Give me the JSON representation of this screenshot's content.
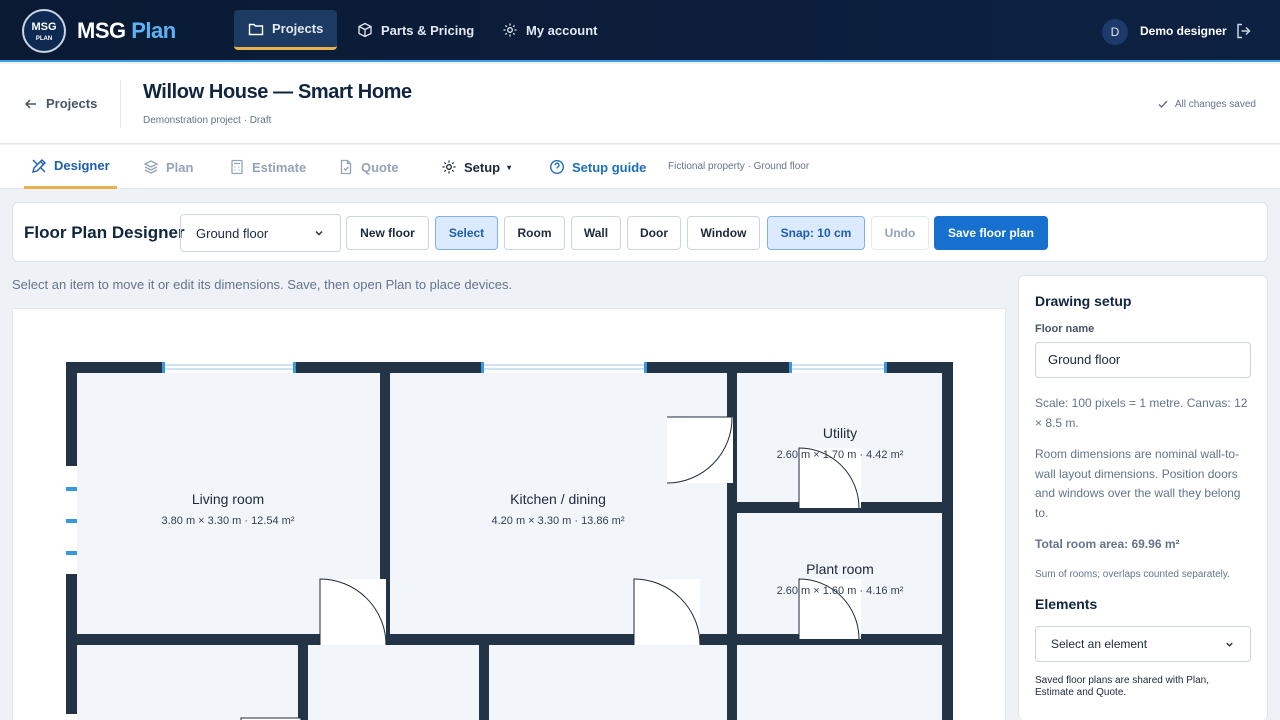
{
  "brand": {
    "logo_line1": "MSG",
    "logo_line2": "PLAN",
    "name": "MSG",
    "name_accent": "Plan"
  },
  "nav": {
    "projects": "Projects",
    "parts": "Parts & Pricing",
    "account": "My account",
    "user_initial": "D",
    "user_name": "Demo designer"
  },
  "project": {
    "back": "Projects",
    "title": "Willow House — Smart Home",
    "subtitle": "Demonstration project · Draft",
    "saved": "All changes saved"
  },
  "tabs": {
    "designer": "Designer",
    "plan": "Plan",
    "estimate": "Estimate",
    "quote": "Quote",
    "setup": "Setup",
    "setup_caret": "▾",
    "guide": "Setup guide",
    "note": "Fictional property · Ground floor"
  },
  "toolbar": {
    "title": "Floor Plan Designer",
    "floor": "Ground floor",
    "new_floor": "New floor",
    "select": "Select",
    "room": "Room",
    "wall": "Wall",
    "door": "Door",
    "window": "Window",
    "snap": "Snap: 10 cm",
    "undo": "Undo",
    "save": "Save floor plan"
  },
  "hint": "Select an item to move it or edit its dimensions. Save, then open Plan to place devices.",
  "rooms": [
    {
      "name": "Living room",
      "dims": "3.80 m × 3.30 m · 12.54 m²"
    },
    {
      "name": "Kitchen / dining",
      "dims": "4.20 m × 3.30 m · 13.86 m²"
    },
    {
      "name": "Utility",
      "dims": "2.60 m × 1.70 m · 4.42 m²"
    },
    {
      "name": "Plant room",
      "dims": "2.60 m × 1.60 m · 4.16 m²"
    }
  ],
  "side": {
    "heading": "Drawing setup",
    "floor_label": "Floor name",
    "floor_value": "Ground floor",
    "scale": "Scale: 100 pixels = 1 metre. Canvas: 12 × 8.5 m.",
    "dims_note": "Room dimensions are nominal wall-to-wall layout dimensions. Position doors and windows over the wall they belong to.",
    "total": "Total room area: 69.96 m²",
    "sum_note": "Sum of rooms; overlaps counted separately.",
    "elements_heading": "Elements",
    "elements_placeholder": "Select an element",
    "footer": "Saved floor plans are shared with Plan, Estimate and Quote."
  }
}
